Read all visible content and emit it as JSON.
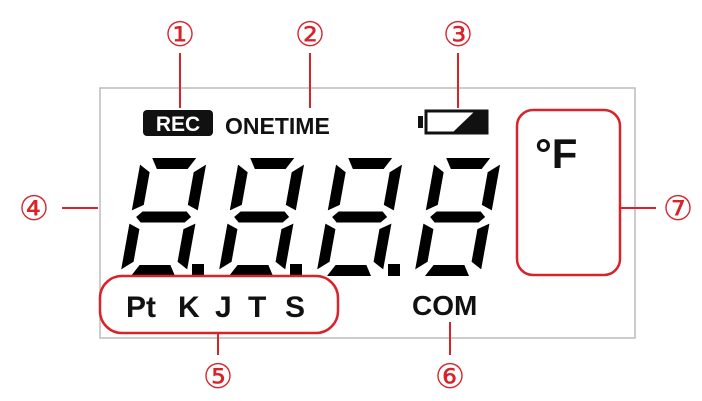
{
  "lcd": {
    "rec_badge": "REC",
    "onetime_label": "ONETIME",
    "unit_label": "°F",
    "sensor_types": [
      "Pt",
      "K",
      "J",
      "T",
      "S"
    ],
    "com_label": "COM",
    "digit_count": 4
  },
  "callouts": [
    {
      "id": "1",
      "label": "①"
    },
    {
      "id": "2",
      "label": "②"
    },
    {
      "id": "3",
      "label": "③"
    },
    {
      "id": "4",
      "label": "④"
    },
    {
      "id": "5",
      "label": "⑤"
    },
    {
      "id": "6",
      "label": "⑥"
    },
    {
      "id": "7",
      "label": "⑦"
    }
  ],
  "colors": {
    "callout": "#d8232a",
    "lcd_frame": "#bbbbbb",
    "lcd_ink": "#000000",
    "background": "#ffffff"
  },
  "icons": {
    "battery": "battery-icon"
  }
}
